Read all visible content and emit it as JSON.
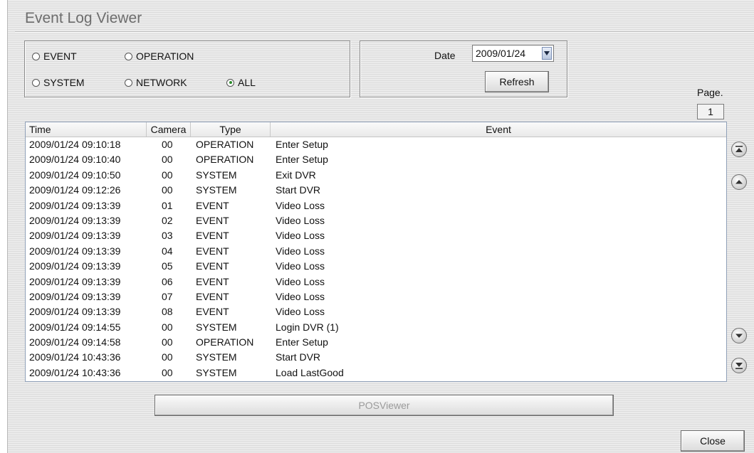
{
  "window": {
    "title": "Event Log Viewer"
  },
  "filters": [
    {
      "label": "EVENT",
      "checked": false
    },
    {
      "label": "OPERATION",
      "checked": false
    },
    {
      "label": "SYSTEM",
      "checked": false
    },
    {
      "label": "NETWORK",
      "checked": false
    },
    {
      "label": "ALL",
      "checked": true
    }
  ],
  "date": {
    "label": "Date",
    "value": "2009/01/24",
    "refresh_label": "Refresh"
  },
  "page": {
    "label": "Page.",
    "number": "1"
  },
  "table": {
    "columns": [
      "Time",
      "Camera",
      "Type",
      "Event"
    ],
    "rows": [
      [
        "2009/01/24 09:10:18",
        "00",
        "OPERATION",
        "Enter Setup"
      ],
      [
        "2009/01/24 09:10:40",
        "00",
        "OPERATION",
        "Enter Setup"
      ],
      [
        "2009/01/24 09:10:50",
        "00",
        "SYSTEM",
        "Exit DVR"
      ],
      [
        "2009/01/24 09:12:26",
        "00",
        "SYSTEM",
        "Start DVR"
      ],
      [
        "2009/01/24 09:13:39",
        "01",
        "EVENT",
        "Video Loss"
      ],
      [
        "2009/01/24 09:13:39",
        "02",
        "EVENT",
        "Video Loss"
      ],
      [
        "2009/01/24 09:13:39",
        "03",
        "EVENT",
        "Video Loss"
      ],
      [
        "2009/01/24 09:13:39",
        "04",
        "EVENT",
        "Video Loss"
      ],
      [
        "2009/01/24 09:13:39",
        "05",
        "EVENT",
        "Video Loss"
      ],
      [
        "2009/01/24 09:13:39",
        "06",
        "EVENT",
        "Video Loss"
      ],
      [
        "2009/01/24 09:13:39",
        "07",
        "EVENT",
        "Video Loss"
      ],
      [
        "2009/01/24 09:13:39",
        "08",
        "EVENT",
        "Video Loss"
      ],
      [
        "2009/01/24 09:14:55",
        "00",
        "SYSTEM",
        "Login DVR (1)"
      ],
      [
        "2009/01/24 09:14:58",
        "00",
        "OPERATION",
        "Enter Setup"
      ],
      [
        "2009/01/24 10:43:36",
        "00",
        "SYSTEM",
        "Start DVR"
      ],
      [
        "2009/01/24 10:43:36",
        "00",
        "SYSTEM",
        "Load LastGood"
      ]
    ]
  },
  "buttons": {
    "posviewer": "POSViewer",
    "close": "Close"
  },
  "icons": {
    "first": "first-page-icon",
    "prev": "prev-page-icon",
    "next": "next-page-icon",
    "last": "last-page-icon"
  }
}
